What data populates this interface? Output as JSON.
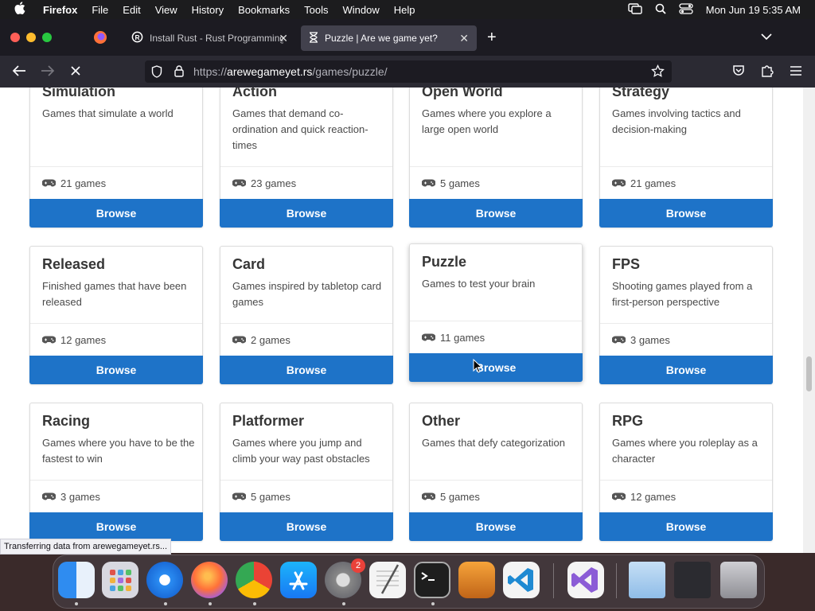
{
  "menubar": {
    "app": "Firefox",
    "items": [
      "File",
      "Edit",
      "View",
      "History",
      "Bookmarks",
      "Tools",
      "Window",
      "Help"
    ],
    "clock": "Mon Jun 19  5:35 AM"
  },
  "tabs": [
    {
      "title": "Install Rust - Rust Programming",
      "active": false
    },
    {
      "title": "Puzzle | Are we game yet?",
      "active": true
    }
  ],
  "url": {
    "prefix": "https://",
    "host": "arewegameyet.rs",
    "path": "/games/puzzle/"
  },
  "cards": [
    {
      "title": "Simulation",
      "desc": "Games that simulate a world",
      "count": "21 games",
      "browse": "Browse"
    },
    {
      "title": "Action",
      "desc": "Games that demand co-ordination and quick reaction-times",
      "count": "23 games",
      "browse": "Browse"
    },
    {
      "title": "Open World",
      "desc": "Games where you explore a large open world",
      "count": "5 games",
      "browse": "Browse"
    },
    {
      "title": "Strategy",
      "desc": "Games involving tactics and decision-making",
      "count": "21 games",
      "browse": "Browse"
    },
    {
      "title": "Released",
      "desc": "Finished games that have been released",
      "count": "12 games",
      "browse": "Browse"
    },
    {
      "title": "Card",
      "desc": "Games inspired by tabletop card games",
      "count": "2 games",
      "browse": "Browse"
    },
    {
      "title": "Puzzle",
      "desc": "Games to test your brain",
      "count": "11 games",
      "browse": "Browse"
    },
    {
      "title": "FPS",
      "desc": "Shooting games played from a first-person perspective",
      "count": "3 games",
      "browse": "Browse"
    },
    {
      "title": "Racing",
      "desc": "Games where you have to be the fastest to win",
      "count": "3 games",
      "browse": "Browse"
    },
    {
      "title": "Platformer",
      "desc": "Games where you jump and climb your way past obstacles",
      "count": "5 games",
      "browse": "Browse"
    },
    {
      "title": "Other",
      "desc": "Games that defy categorization",
      "count": "5 games",
      "browse": "Browse"
    },
    {
      "title": "RPG",
      "desc": "Games where you roleplay as a character",
      "count": "12 games",
      "browse": "Browse"
    }
  ],
  "status_text": "Transferring data from arewegameyet.rs...",
  "dock": {
    "apps": [
      "finder-icon",
      "launchpad-icon",
      "safari-icon",
      "firefox-icon",
      "chrome-icon",
      "app-store-icon",
      "system-settings-icon",
      "textedit-icon",
      "terminal-icon",
      "garageband-icon",
      "vscode-icon",
      "visual-studio-icon",
      "downloads-folder-icon",
      "screenshot-stack-icon",
      "trash-icon"
    ],
    "badge": "2"
  },
  "colors": {
    "accent": "#1e73c8",
    "chrome_dark": "#1c1b22",
    "toolbar": "#2b2a33"
  }
}
